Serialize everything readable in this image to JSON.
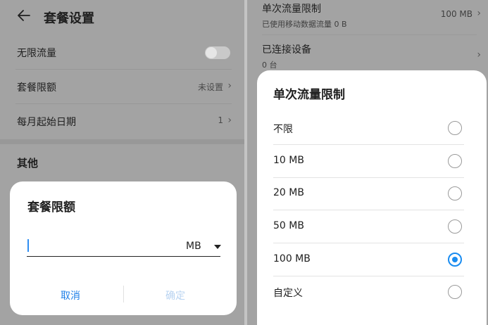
{
  "left": {
    "header": {
      "title": "套餐设置"
    },
    "rows": [
      {
        "label": "无限流量",
        "type": "toggle",
        "on": false
      },
      {
        "label": "套餐限额",
        "value": "未设置"
      },
      {
        "label": "每月起始日期",
        "value": "1"
      }
    ],
    "section_title": "其他",
    "dialog": {
      "title": "套餐限额",
      "input_value": "",
      "unit": "MB",
      "cancel_label": "取消",
      "ok_label": "确定"
    }
  },
  "right": {
    "rows": [
      {
        "label": "单次流量限制",
        "sub": "已使用移动数据流量 0 B",
        "value": "100 MB"
      },
      {
        "label": "已连接设备",
        "sub": "0 台"
      }
    ],
    "dialog": {
      "title": "单次流量限制",
      "options": [
        {
          "label": "不限",
          "selected": false
        },
        {
          "label": "10 MB",
          "selected": false
        },
        {
          "label": "20 MB",
          "selected": false
        },
        {
          "label": "50 MB",
          "selected": false
        },
        {
          "label": "100 MB",
          "selected": true
        },
        {
          "label": "自定义",
          "selected": false
        }
      ]
    }
  },
  "colors": {
    "accent": "#1a8cf0",
    "disabled_accent": "#b8d3f1",
    "dim_background": "#a3a3a3"
  },
  "icons": {
    "back": "back-arrow-icon",
    "chevron": "chevron-right-icon",
    "dropdown": "caret-down-icon"
  }
}
